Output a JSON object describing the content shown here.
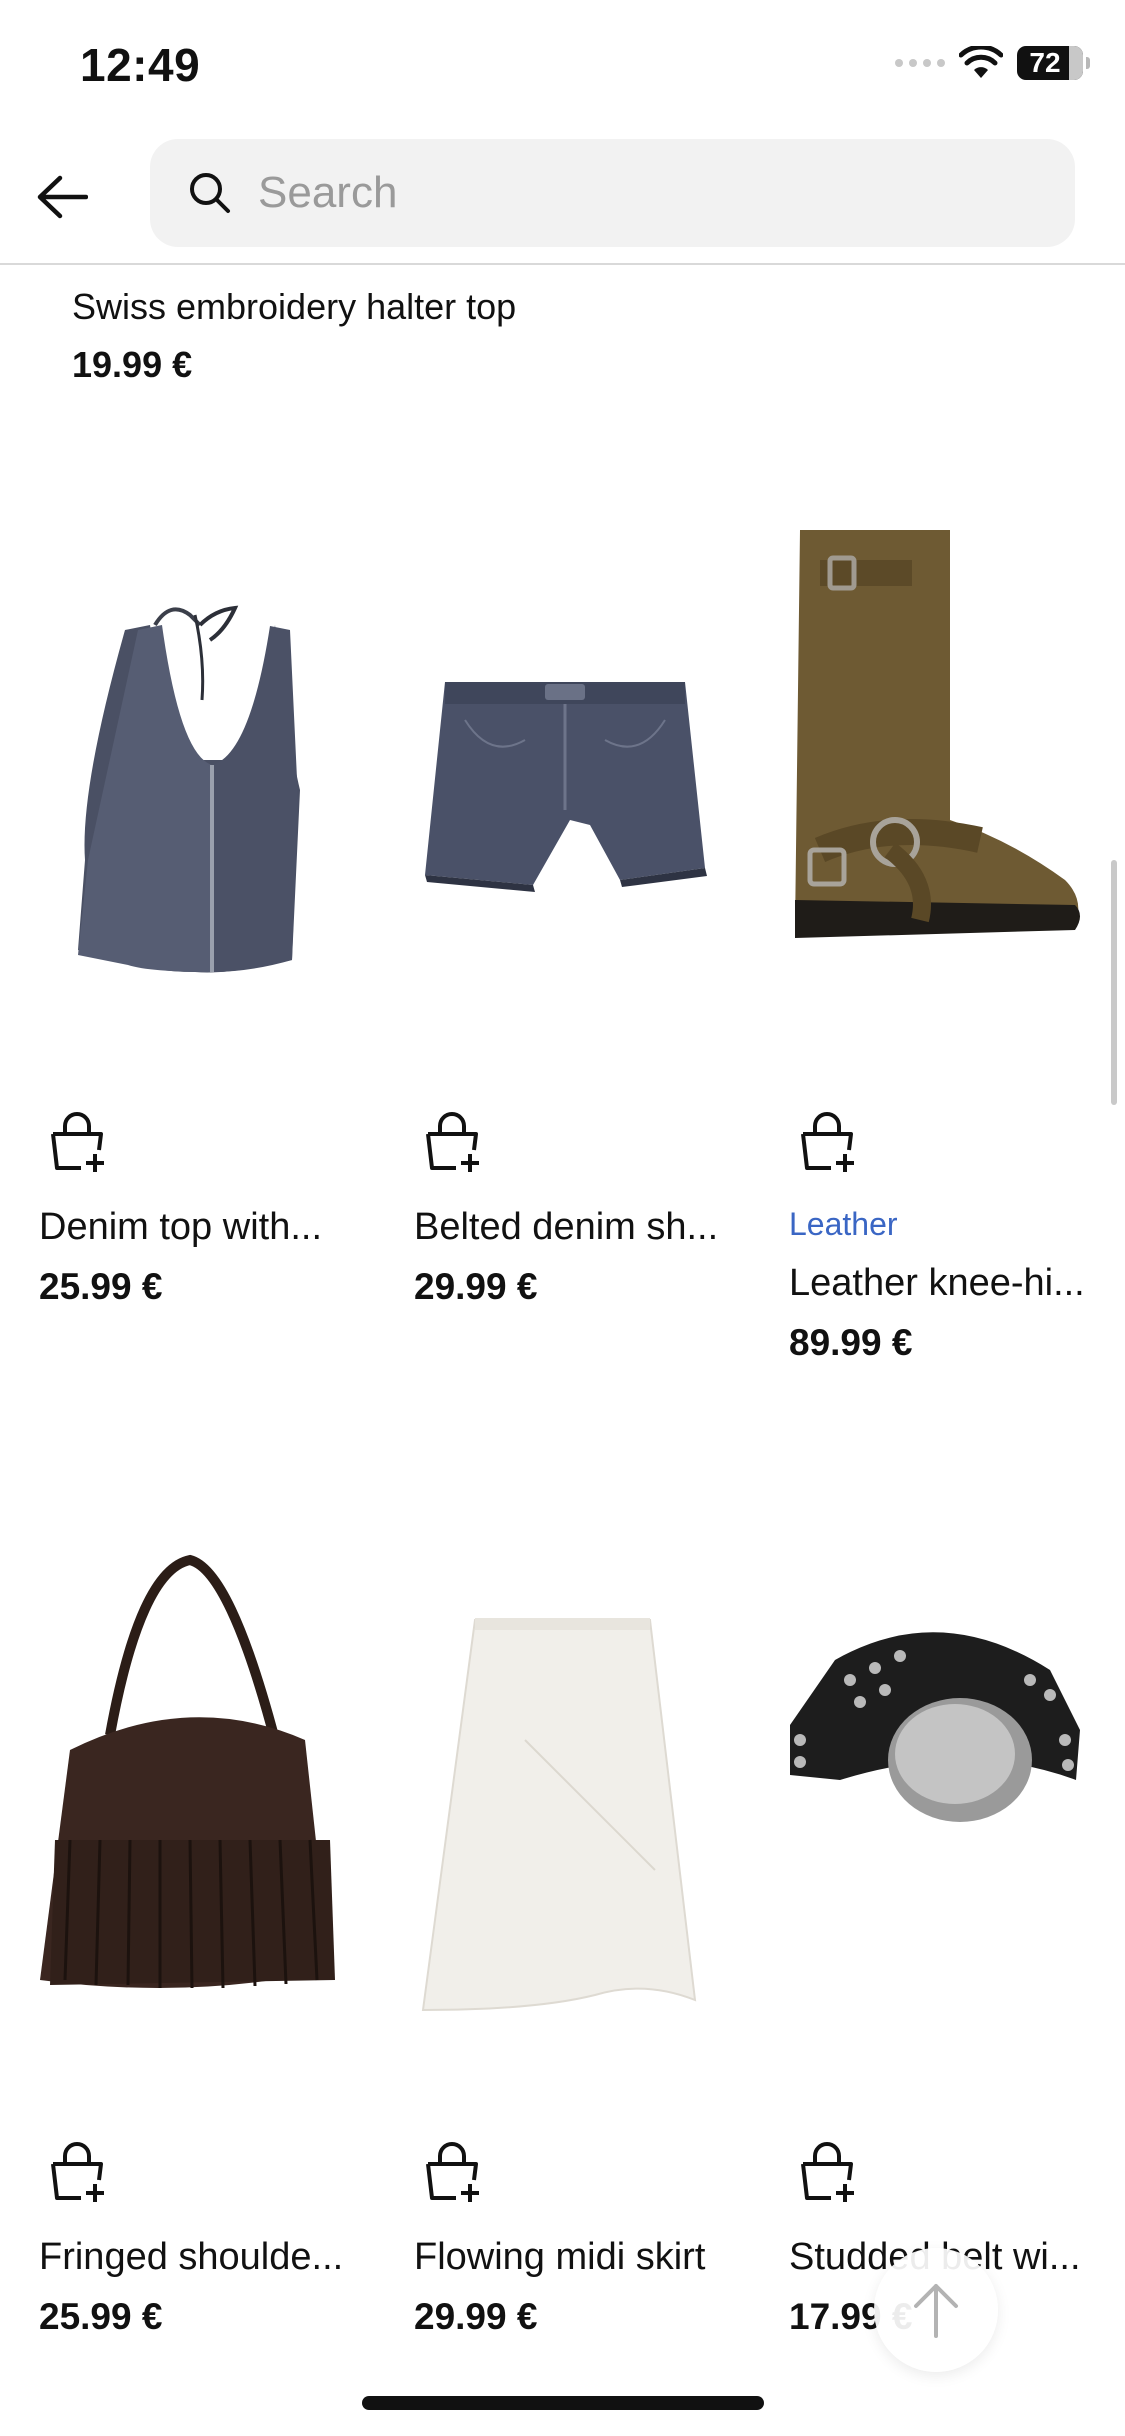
{
  "status_bar": {
    "time": "12:49",
    "battery": "72"
  },
  "search": {
    "placeholder": "Search",
    "value": ""
  },
  "top_item": {
    "name": "Swiss embroidery halter top",
    "price": "19.99 €"
  },
  "products": [
    {
      "name": "Denim top with...",
      "price": "25.99 €",
      "brand": "",
      "image": "denim-halter-top"
    },
    {
      "name": "Belted denim sh...",
      "price": "29.99 €",
      "brand": "",
      "image": "denim-shorts"
    },
    {
      "name": "Leather knee-hi...",
      "price": "89.99 €",
      "brand": "Leather",
      "image": "suede-biker-boot"
    },
    {
      "name": "Fringed shoulde...",
      "price": "25.99 €",
      "brand": "",
      "image": "fringed-bag"
    },
    {
      "name": "Flowing midi skirt",
      "price": "29.99 €",
      "brand": "",
      "image": "white-midi-skirt"
    },
    {
      "name": "Studded belt wi...",
      "price": "17.99 €",
      "brand": "",
      "image": "studded-belt"
    }
  ],
  "colors": {
    "brand_blue": "#3a66c4",
    "text": "#111111",
    "search_bg": "#f2f2f2"
  }
}
